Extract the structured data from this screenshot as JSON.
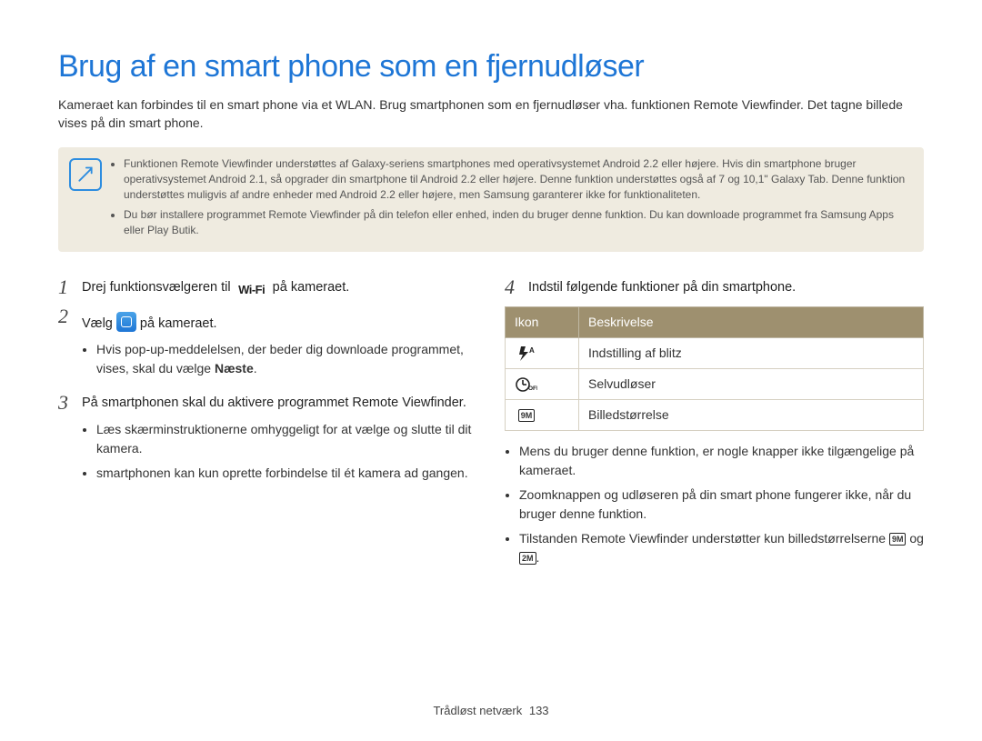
{
  "title": "Brug af en smart phone som en fjernudløser",
  "intro": "Kameraet kan forbindes til en smart phone via et WLAN. Brug smartphonen som en fjernudløser vha. funktionen Remote Viewfinder. Det tagne billede vises på din smart phone.",
  "note": {
    "items": [
      "Funktionen Remote Viewfinder understøttes af Galaxy-seriens smartphones med operativsystemet Android 2.2 eller højere. Hvis din smartphone bruger operativsystemet Android 2.1, så opgrader din smartphone til Android 2.2 eller højere. Denne funktion understøttes også af 7 og 10,1\" Galaxy Tab. Denne funktion understøttes muligvis af andre enheder med Android 2.2 eller højere, men Samsung garanterer ikke for funktionaliteten.",
      "Du bør installere programmet Remote Viewfinder på din telefon eller enhed, inden du bruger denne funktion. Du kan downloade programmet fra Samsung Apps eller Play Butik."
    ]
  },
  "left": {
    "step1": {
      "num": "1",
      "prefix": "Drej funktionsvælgeren til ",
      "wifi": "Wi-Fi",
      "suffix": " på kameraet."
    },
    "step2": {
      "num": "2",
      "prefix": "Vælg ",
      "suffix": " på kameraet.",
      "bullet_prefix": "Hvis pop-up-meddelelsen, der beder dig downloade programmet, vises, skal du vælge ",
      "bullet_bold": "Næste",
      "bullet_suffix": "."
    },
    "step3": {
      "num": "3",
      "text": "På smartphonen skal du aktivere programmet Remote Viewfinder.",
      "bullets": [
        "Læs skærminstruktionerne omhyggeligt for at vælge og slutte til dit kamera.",
        "smartphonen kan kun oprette forbindelse til ét kamera ad gangen."
      ]
    }
  },
  "right": {
    "step4": {
      "num": "4",
      "text": "Indstil følgende funktioner på din smartphone."
    },
    "table": {
      "head_icon": "Ikon",
      "head_desc": "Beskrivelse",
      "rows": [
        {
          "desc": "Indstilling af blitz"
        },
        {
          "desc": "Selvudløser"
        },
        {
          "desc": "Billedstørrelse"
        }
      ]
    },
    "bullets": {
      "b1": "Mens du bruger denne funktion, er nogle knapper ikke tilgængelige på kameraet.",
      "b2": "Zoomknappen og udløseren på din smart phone fungerer ikke, når du bruger denne funktion.",
      "b3_prefix": "Tilstanden Remote Viewfinder understøtter kun billedstørrelserne ",
      "b3_size1": "9M",
      "b3_mid": " og ",
      "b3_size2": "2M",
      "b3_suffix": "."
    }
  },
  "footer": {
    "section": "Trådløst netværk",
    "page": "133"
  }
}
